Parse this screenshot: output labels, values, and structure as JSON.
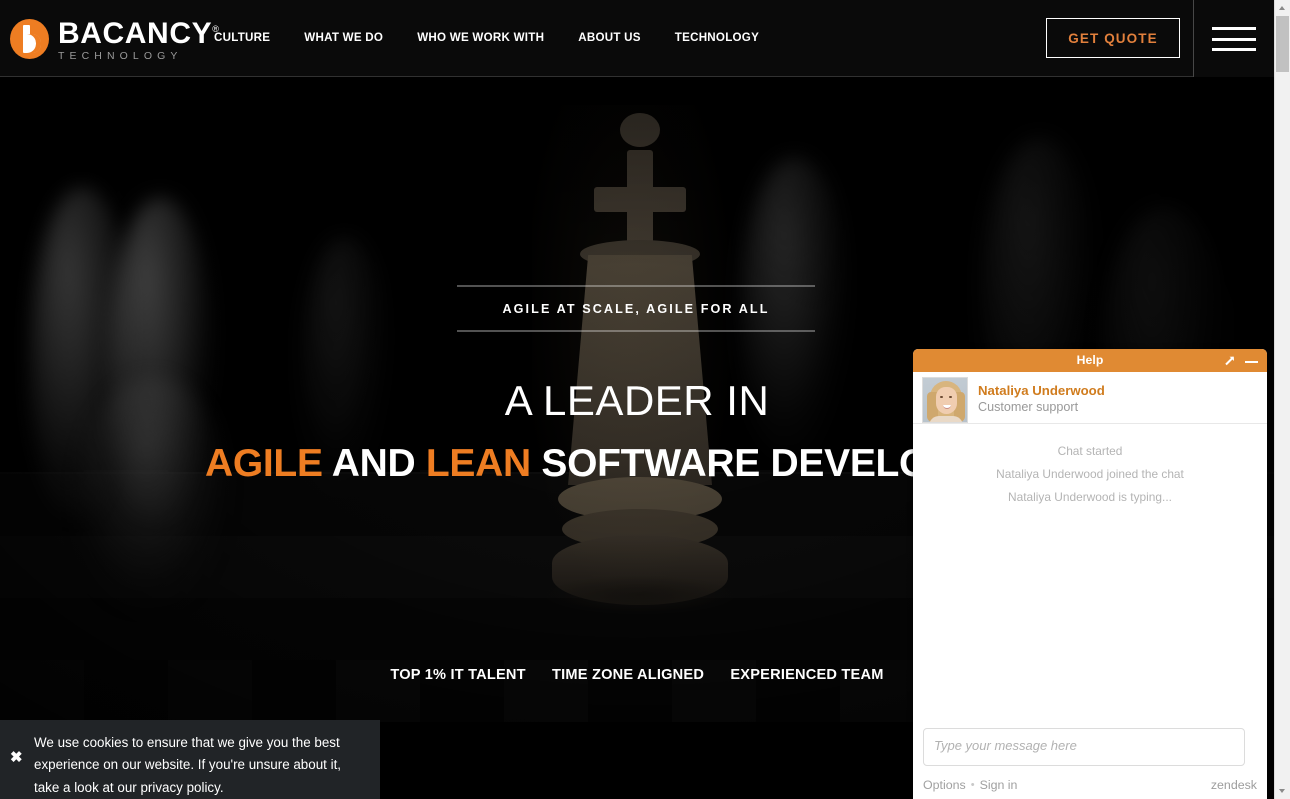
{
  "site": {
    "logo": {
      "word": "BACANCY",
      "trademark": "®",
      "subtitle": "TECHNOLOGY"
    },
    "nav": [
      {
        "label": "CULTURE"
      },
      {
        "label": "WHAT WE DO"
      },
      {
        "label": "WHO WE WORK WITH"
      },
      {
        "label": "ABOUT US"
      },
      {
        "label": "TECHNOLOGY"
      }
    ],
    "cta": {
      "label": "GET QUOTE"
    },
    "menu_icon": "hamburger-icon",
    "accent_color": "#ee7d22"
  },
  "hero": {
    "tagline": "AGILE AT SCALE, AGILE FOR ALL",
    "headline_line1": "A LEADER IN",
    "headline_parts": [
      {
        "text": "AGILE",
        "accent": true
      },
      {
        "text": " AND ",
        "accent": false
      },
      {
        "text": "LEAN",
        "accent": true
      },
      {
        "text": " SOFTWARE DEVELO",
        "accent": false
      }
    ],
    "headline_line2_full": "AGILE AND LEAN SOFTWARE DEVELO",
    "features": [
      {
        "label": "TOP 1% IT TALENT"
      },
      {
        "label": "TIME ZONE ALIGNED"
      },
      {
        "label": "EXPERIENCED TEAM"
      }
    ],
    "background": "dark-chess-king-piece"
  },
  "cookie_banner": {
    "close_icon": "close-icon",
    "text": "We use cookies to ensure that we give you the best experience on our website. If you're unsure about it, take a look at our privacy policy.",
    "background_color": "#212427"
  },
  "chat": {
    "header_title": "Help",
    "header_color": "#e08a33",
    "expand_icon": "expand-arrow-icon",
    "minimize_icon": "minimize-icon",
    "agent": {
      "name": "Nataliya Underwood",
      "role": "Customer support",
      "avatar": "agent-photo-avatar"
    },
    "messages": [
      {
        "text": "Chat started"
      },
      {
        "text": "Nataliya Underwood joined the chat"
      },
      {
        "text": "Nataliya Underwood is typing..."
      }
    ],
    "input_placeholder": "Type your message here",
    "input_value": "",
    "footer": {
      "options_label": "Options",
      "separator": "•",
      "signin_label": "Sign in",
      "brand": "zendesk"
    }
  },
  "browser": {
    "scrollbar": {
      "up_icon": "scroll-up-arrow-icon",
      "down_icon": "scroll-down-arrow-icon"
    }
  }
}
